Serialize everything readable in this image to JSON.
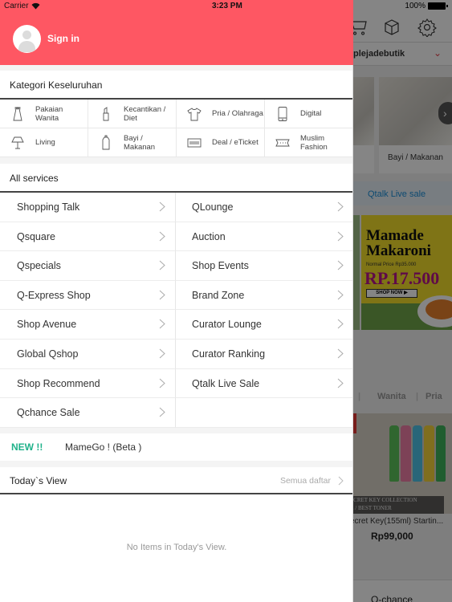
{
  "status_bar": {
    "carrier": "Carrier",
    "time": "3:23 PM",
    "battery": "100%"
  },
  "drawer": {
    "header": {
      "sign_in_label": "Sign in",
      "color": "#fe5763"
    },
    "categories": {
      "title": "Kategori Keseluruhan",
      "items": [
        {
          "label": "Pakaian Wanita",
          "icon": "dress-icon"
        },
        {
          "label": "Kecantikan / Diet",
          "icon": "lipstick-icon"
        },
        {
          "label": "Pria / Olahraga",
          "icon": "tshirt-icon"
        },
        {
          "label": "Digital",
          "icon": "smartphone-icon"
        },
        {
          "label": "Living",
          "icon": "lamp-icon"
        },
        {
          "label": "Bayi / Makanan",
          "icon": "baby-bottle-icon"
        },
        {
          "label": "Deal / eTicket",
          "icon": "barcode-ticket-icon"
        },
        {
          "label": "Muslim Fashion",
          "icon": "scarf-icon"
        }
      ]
    },
    "services": {
      "title": "All services",
      "items": [
        {
          "label": "Shopping Talk"
        },
        {
          "label": "QLounge"
        },
        {
          "label": "Qsquare"
        },
        {
          "label": "Auction"
        },
        {
          "label": "Qspecials"
        },
        {
          "label": "Shop Events"
        },
        {
          "label": "Q-Express Shop"
        },
        {
          "label": "Brand Zone"
        },
        {
          "label": "Shop Avenue"
        },
        {
          "label": "Curator Lounge"
        },
        {
          "label": "Global Qshop"
        },
        {
          "label": "Curator Ranking"
        },
        {
          "label": "Shop Recommend"
        },
        {
          "label": "Qtalk Live Sale"
        },
        {
          "label": "Qchance Sale"
        }
      ]
    },
    "new_feature": {
      "badge": "NEW !!",
      "label": "MameGo ! (Beta )",
      "badge_color": "#1fb28a"
    },
    "todays_view": {
      "title": "Today`s View",
      "see_all": "Semua daftar",
      "empty_message": "No Items in Today's View."
    }
  },
  "background": {
    "shop_name": "plejadebutik",
    "category_card_label": "Bayi / Makanan",
    "qtalk_label": "Qtalk Live sale",
    "banner": {
      "title_line1": "Mamade",
      "title_line2": "Makaroni",
      "normal_price": "Normal Price Rp35.000",
      "price": "RP.17.500",
      "cta": "SHOP NOW ▶"
    },
    "tabs": [
      "a",
      "Wanita",
      "Pria"
    ],
    "product": {
      "caption_line1": "SECRET KEY COLLECTION",
      "caption_line2": "TE / BEST TONER",
      "name": "ecret Key(155ml) Startin...",
      "price": "Rp99,000"
    },
    "bottom_label": "Q-chance"
  }
}
